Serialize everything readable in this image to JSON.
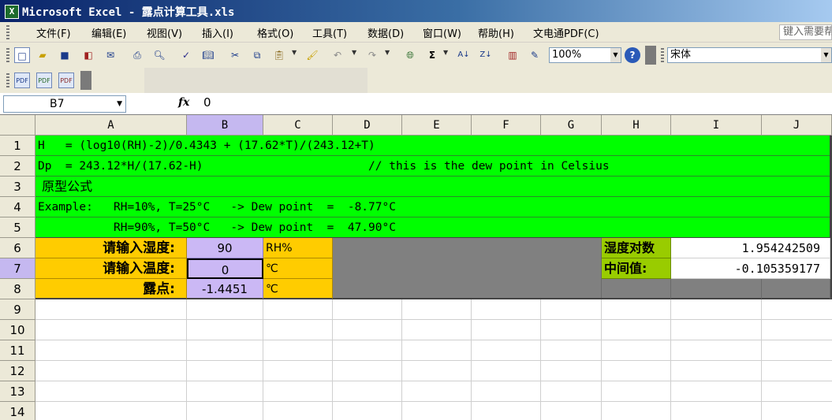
{
  "window": {
    "title": "Microsoft Excel - 露点计算工具.xls"
  },
  "menu": {
    "items": [
      "文件(F)",
      "编辑(E)",
      "视图(V)",
      "插入(I)",
      "格式(O)",
      "工具(T)",
      "数据(D)",
      "窗口(W)",
      "帮助(H)",
      "文电通PDF(C)"
    ],
    "help_placeholder": "键入需要帮"
  },
  "toolbar": {
    "zoom": "100%",
    "font": "宋体"
  },
  "formula_bar": {
    "name_box": "B7",
    "fx_label": "fx",
    "value": "0"
  },
  "sheet": {
    "columns": [
      "A",
      "B",
      "C",
      "D",
      "E",
      "F",
      "G",
      "H",
      "I",
      "J"
    ],
    "rows": [
      "1",
      "2",
      "3",
      "4",
      "5",
      "6",
      "7",
      "8",
      "9",
      "10",
      "11",
      "12",
      "13",
      "14"
    ],
    "bands": {
      "r1": "H   = (log10(RH)-2)/0.4343 + (17.62*T)/(243.12+T)",
      "r2": "Dp  = 243.12*H/(17.62-H)                        // this is the dew point in Celsius",
      "r3": " 原型公式",
      "r4": "Example:   RH=10%, T=25°C   -> Dew point  =  -8.77°C",
      "r5": "           RH=90%, T=50°C   -> Dew point  =  47.90°C"
    },
    "inputs": {
      "humidity_label": "请输入湿度:",
      "humidity_value": "90",
      "humidity_unit": "RH%",
      "temp_label": "请输入温度:",
      "temp_value": "0",
      "temp_unit": "℃",
      "dew_label": "露点:",
      "dew_value": "-1.4451",
      "dew_unit": "℃"
    },
    "side": {
      "log_label": "湿度对数",
      "log_value": "1.954242509",
      "mid_label": "中间值:",
      "mid_value": "-0.105359177"
    }
  }
}
